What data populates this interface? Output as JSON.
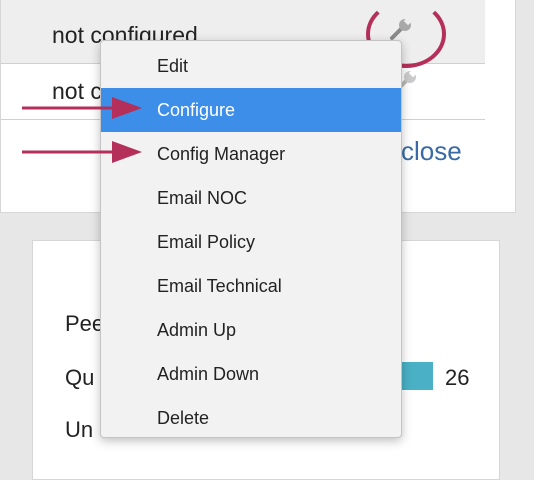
{
  "table": {
    "rows": [
      {
        "status": "not configured"
      },
      {
        "status": "not c"
      }
    ],
    "close_label": "close"
  },
  "stats": {
    "labels": [
      "Pee",
      "Qu",
      "Un"
    ],
    "value": "26",
    "swatch_color": "#4ab0c5"
  },
  "context_menu": {
    "items": [
      {
        "label": "Edit",
        "active": false
      },
      {
        "label": "Configure",
        "active": true
      },
      {
        "label": "Config Manager",
        "active": false
      },
      {
        "label": "Email NOC",
        "active": false
      },
      {
        "label": "Email Policy",
        "active": false
      },
      {
        "label": "Email Technical",
        "active": false
      },
      {
        "label": "Admin Up",
        "active": false
      },
      {
        "label": "Admin Down",
        "active": false
      },
      {
        "label": "Delete",
        "active": false
      }
    ]
  },
  "icons": {
    "row_action": "wrench-icon",
    "annotation": "arrow-right-icon"
  },
  "colors": {
    "menu_highlight": "#3d8ee8",
    "annotation": "#b4305a",
    "link": "#3a6aa5"
  }
}
